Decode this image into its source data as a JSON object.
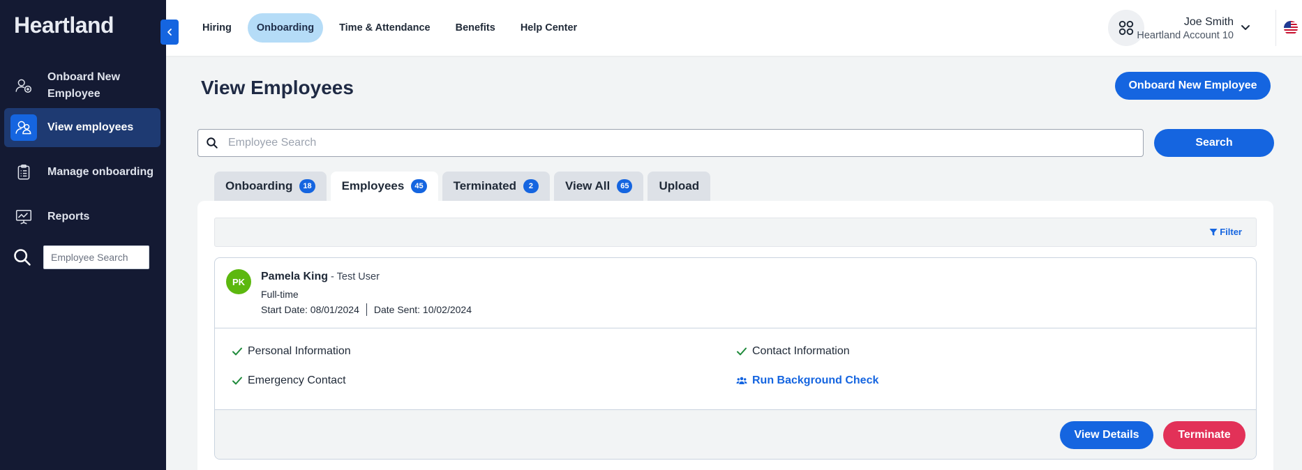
{
  "brand": {
    "logo_text": "Heartland",
    "accent": "#1565e0",
    "sidebar_bg": "#141a33",
    "danger": "#e23158"
  },
  "sidebar": {
    "items": [
      {
        "label": "Onboard New Employee",
        "icon": "user-add-icon"
      },
      {
        "label": "View employees",
        "icon": "users-icon",
        "active": true
      },
      {
        "label": "Manage onboarding",
        "icon": "clipboard-icon"
      },
      {
        "label": "Reports",
        "icon": "presentation-chart-icon"
      }
    ],
    "search_placeholder": "Employee Search"
  },
  "topnav": {
    "items": [
      "Hiring",
      "Onboarding",
      "Time & Attendance",
      "Benefits",
      "Help Center"
    ],
    "active": "Onboarding"
  },
  "user": {
    "name": "Joe Smith",
    "account": "Heartland Account 10"
  },
  "main": {
    "title": "View Employees",
    "onboard_button": "Onboard New Employee",
    "search_placeholder": "Employee Search",
    "search_button": "Search",
    "tabs": [
      {
        "label": "Onboarding",
        "count": "18"
      },
      {
        "label": "Employees",
        "count": "45",
        "active": true
      },
      {
        "label": "Terminated",
        "count": "2"
      },
      {
        "label": "View All",
        "count": "65"
      },
      {
        "label": "Upload",
        "count": null
      }
    ],
    "filter_label": "Filter",
    "employee": {
      "initials": "PK",
      "name": "Pamela King",
      "role_sep": " - ",
      "role": "Test User",
      "type": "Full-time",
      "start_date": "Start Date: 08/01/2024",
      "date_sent": "Date Sent: 10/02/2024",
      "checklist": {
        "personal": "Personal Information",
        "contact": "Contact Information",
        "emergency": "Emergency Contact",
        "background": "Run Background Check"
      },
      "view_details": "View Details",
      "terminate": "Terminate"
    }
  }
}
